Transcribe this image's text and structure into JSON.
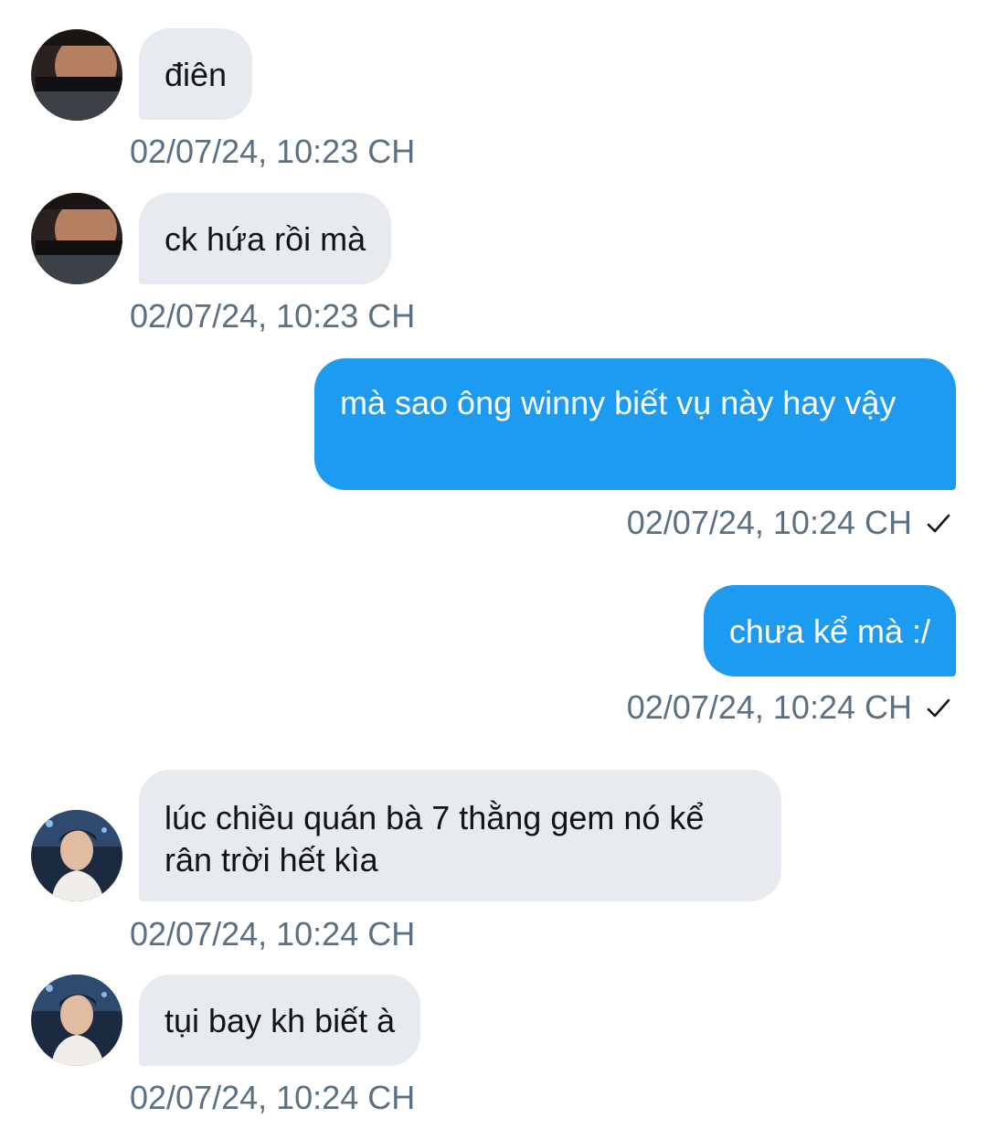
{
  "messages": [
    {
      "direction": "incoming",
      "sender_avatar": "avatar-user-a",
      "text": "điên",
      "time": "02/07/24, 10:23 CH"
    },
    {
      "direction": "incoming",
      "sender_avatar": "avatar-user-a",
      "text": "ck hứa rồi mà",
      "time": "02/07/24, 10:23 CH"
    },
    {
      "direction": "outgoing",
      "text": "mà sao ông winny biết vụ này hay vậy",
      "time": "02/07/24, 10:24 CH",
      "status_icon": "check-icon"
    },
    {
      "direction": "outgoing",
      "text": "chưa kể mà :/",
      "time": "02/07/24, 10:24 CH",
      "status_icon": "check-icon"
    },
    {
      "direction": "incoming",
      "sender_avatar": "avatar-user-b",
      "text": "lúc chiều quán bà 7 thằng gem nó kể rân trời hết kìa",
      "time": "02/07/24, 10:24 CH"
    },
    {
      "direction": "incoming",
      "sender_avatar": "avatar-user-b",
      "text": "tụi bay kh biết à",
      "time": "02/07/24, 10:24 CH"
    }
  ],
  "colors": {
    "incoming_bubble": "#e7ebef",
    "outgoing_bubble": "#1d9bf0",
    "timestamp": "#5b7083"
  }
}
